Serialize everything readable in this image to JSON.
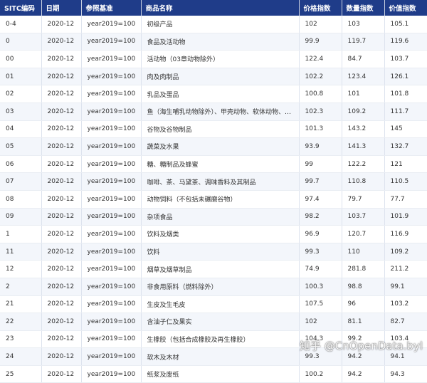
{
  "table": {
    "headers": [
      "SITC编码",
      "日期",
      "参照基准",
      "商品名称",
      "价格指数",
      "数量指数",
      "价值指数"
    ],
    "rows": [
      [
        "0-4",
        "2020-12",
        "year2019=100",
        "初级产品",
        "102",
        "103",
        "105.1"
      ],
      [
        "0",
        "2020-12",
        "year2019=100",
        "食品及活动物",
        "99.9",
        "119.7",
        "119.6"
      ],
      [
        "00",
        "2020-12",
        "year2019=100",
        "活动物（03章动物除外）",
        "122.4",
        "84.7",
        "103.7"
      ],
      [
        "01",
        "2020-12",
        "year2019=100",
        "肉及肉制品",
        "102.2",
        "123.4",
        "126.1"
      ],
      [
        "02",
        "2020-12",
        "year2019=100",
        "乳品及蛋品",
        "100.8",
        "101",
        "101.8"
      ],
      [
        "03",
        "2020-12",
        "year2019=100",
        "鱼（海生哺乳动物除外）、甲壳动物、软体动物、…",
        "102.3",
        "109.2",
        "111.7"
      ],
      [
        "04",
        "2020-12",
        "year2019=100",
        "谷物及谷物制品",
        "101.3",
        "143.2",
        "145"
      ],
      [
        "05",
        "2020-12",
        "year2019=100",
        "蔬菜及水果",
        "93.9",
        "141.3",
        "132.7"
      ],
      [
        "06",
        "2020-12",
        "year2019=100",
        "糖、糖制品及蜂蜜",
        "99",
        "122.2",
        "121"
      ],
      [
        "07",
        "2020-12",
        "year2019=100",
        "咖啡、茶、马黛茶、调味香料及其制品",
        "99.7",
        "110.8",
        "110.5"
      ],
      [
        "08",
        "2020-12",
        "year2019=100",
        "动物饲料（不包括未碾磨谷物）",
        "97.4",
        "79.7",
        "77.7"
      ],
      [
        "09",
        "2020-12",
        "year2019=100",
        "杂项食品",
        "98.2",
        "103.7",
        "101.9"
      ],
      [
        "1",
        "2020-12",
        "year2019=100",
        "饮料及烟类",
        "96.9",
        "120.7",
        "116.9"
      ],
      [
        "11",
        "2020-12",
        "year2019=100",
        "饮料",
        "99.3",
        "110",
        "109.2"
      ],
      [
        "12",
        "2020-12",
        "year2019=100",
        "烟草及烟草制品",
        "74.9",
        "281.8",
        "211.2"
      ],
      [
        "2",
        "2020-12",
        "year2019=100",
        "非食用原料（燃料除外）",
        "100.3",
        "98.8",
        "99.1"
      ],
      [
        "21",
        "2020-12",
        "year2019=100",
        "生皮及生毛皮",
        "107.5",
        "96",
        "103.2"
      ],
      [
        "22",
        "2020-12",
        "year2019=100",
        "含油子仁及果实",
        "102",
        "81.1",
        "82.7"
      ],
      [
        "23",
        "2020-12",
        "year2019=100",
        "生橡胶（包括合成橡胶及再生橡胶）",
        "104.3",
        "99.2",
        "103.4"
      ],
      [
        "24",
        "2020-12",
        "year2019=100",
        "软木及木材",
        "99.3",
        "94.2",
        "94.1"
      ],
      [
        "25",
        "2020-12",
        "year2019=100",
        "纸浆及废纸",
        "100.2",
        "94.2",
        "94.3"
      ]
    ]
  },
  "watermark": "知乎 @CnOpenData.byl"
}
